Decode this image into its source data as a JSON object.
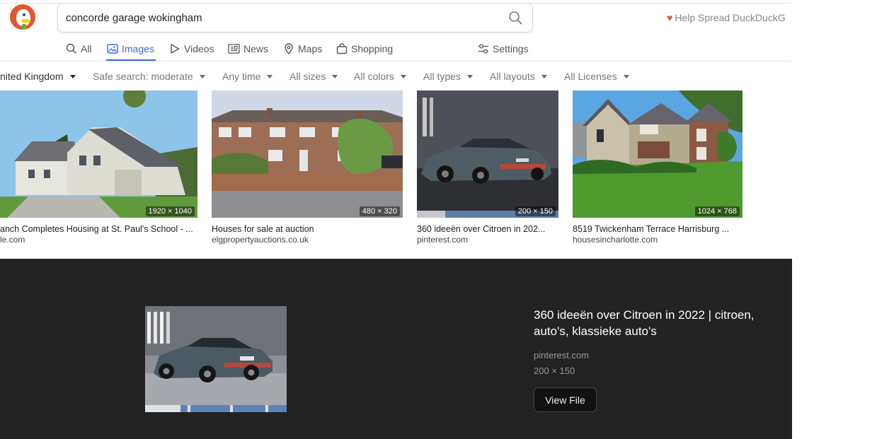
{
  "header": {
    "search_query": "concorde garage wokingham",
    "spread_text": "Help Spread DuckDuckG"
  },
  "tabs": [
    {
      "label": "All",
      "icon": "search-icon"
    },
    {
      "label": "Images",
      "icon": "image-icon",
      "active": true
    },
    {
      "label": "Videos",
      "icon": "play-icon"
    },
    {
      "label": "News",
      "icon": "newspaper-icon"
    },
    {
      "label": "Maps",
      "icon": "map-pin-icon"
    },
    {
      "label": "Shopping",
      "icon": "shopping-bag-icon"
    },
    {
      "label": "Settings",
      "icon": "sliders-icon"
    }
  ],
  "filters": [
    {
      "label": "nited Kingdom"
    },
    {
      "label": "Safe search: moderate"
    },
    {
      "label": "Any time"
    },
    {
      "label": "All sizes"
    },
    {
      "label": "All colors"
    },
    {
      "label": "All types"
    },
    {
      "label": "All layouts"
    },
    {
      "label": "All Licenses"
    }
  ],
  "results": [
    {
      "title": "anch Completes Housing at St. Paul's School - ...",
      "source": "le.com",
      "dims": "1920 × 1040",
      "image": "white-house-photo"
    },
    {
      "title": "Houses for sale at auction",
      "source": "elgpropertyauctions.co.uk",
      "dims": "480 × 320",
      "image": "brick-terrace-photo"
    },
    {
      "title": "360 ideeën over Citroen in 202...",
      "source": "pinterest.com",
      "dims": "200 × 150",
      "image": "citroen-car-photo"
    },
    {
      "title": "8519 Twickenham Terrace Harrisburg ...",
      "source": "housesincharlotte.com",
      "dims": "1024 × 768",
      "image": "suburban-house-photo"
    }
  ],
  "detail": {
    "title": "360 ideeën over Citroen in 2022 | citroen, auto's, klassieke auto's",
    "source": "pinterest.com",
    "dims": "200 × 150",
    "button_label": "View File"
  },
  "colors": {
    "accent": "#3969ef",
    "brand": "#de5833",
    "detail_bg": "#222222"
  }
}
